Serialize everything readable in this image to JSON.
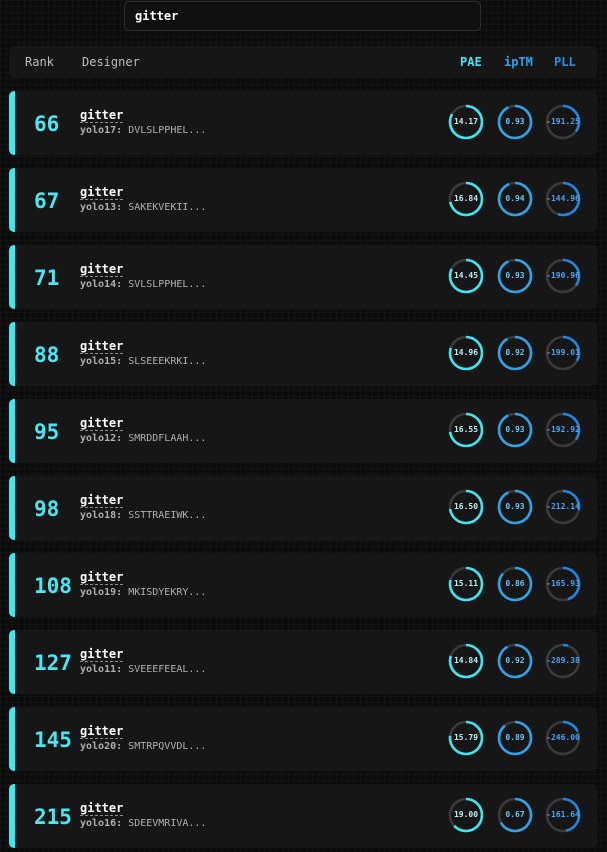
{
  "search": {
    "value": "gitter"
  },
  "header": {
    "rank": "Rank",
    "designer": "Designer",
    "pae": "PAE",
    "iptm": "ipTM",
    "pll": "PLL"
  },
  "colors": {
    "pae": "#3ee6f0",
    "iptm": "#2fa3e8",
    "pll": "#1e86e0",
    "track": "#3a3a3c",
    "accent": "#3ee6f0"
  },
  "rows": [
    {
      "rank": "66",
      "designer": "gitter",
      "model": "yolo17:",
      "sequence": "DVLSLPPHEL...",
      "pae": "14.17",
      "pae_frac": 0.83,
      "iptm": "0.93",
      "iptm_frac": 0.93,
      "pll": "-191.25",
      "pll_frac": 0.35
    },
    {
      "rank": "67",
      "designer": "gitter",
      "model": "yolo13:",
      "sequence": "SAKEKVEKII...",
      "pae": "16.84",
      "pae_frac": 0.72,
      "iptm": "0.94",
      "iptm_frac": 0.94,
      "pll": "-144.96",
      "pll_frac": 0.55
    },
    {
      "rank": "71",
      "designer": "gitter",
      "model": "yolo14:",
      "sequence": "SVLSLPPHEL...",
      "pae": "14.45",
      "pae_frac": 0.82,
      "iptm": "0.93",
      "iptm_frac": 0.93,
      "pll": "-190.96",
      "pll_frac": 0.35
    },
    {
      "rank": "88",
      "designer": "gitter",
      "model": "yolo15:",
      "sequence": "SLSEEEKRKI...",
      "pae": "14.96",
      "pae_frac": 0.8,
      "iptm": "0.92",
      "iptm_frac": 0.92,
      "pll": "-199.01",
      "pll_frac": 0.33
    },
    {
      "rank": "95",
      "designer": "gitter",
      "model": "yolo12:",
      "sequence": "SMRDDFLAAH...",
      "pae": "16.55",
      "pae_frac": 0.73,
      "iptm": "0.93",
      "iptm_frac": 0.93,
      "pll": "-192.92",
      "pll_frac": 0.35
    },
    {
      "rank": "98",
      "designer": "gitter",
      "model": "yolo18:",
      "sequence": "SSTTRAEIWK...",
      "pae": "16.50",
      "pae_frac": 0.73,
      "iptm": "0.93",
      "iptm_frac": 0.93,
      "pll": "-212.14",
      "pll_frac": 0.28
    },
    {
      "rank": "108",
      "designer": "gitter",
      "model": "yolo19:",
      "sequence": "MKISDYEKRY...",
      "pae": "15.11",
      "pae_frac": 0.79,
      "iptm": "0.86",
      "iptm_frac": 0.86,
      "pll": "-165.93",
      "pll_frac": 0.45
    },
    {
      "rank": "127",
      "designer": "gitter",
      "model": "yolo11:",
      "sequence": "SVEEEFEEAL...",
      "pae": "14.84",
      "pae_frac": 0.8,
      "iptm": "0.92",
      "iptm_frac": 0.92,
      "pll": "-289.38",
      "pll_frac": 0.05
    },
    {
      "rank": "145",
      "designer": "gitter",
      "model": "yolo20:",
      "sequence": "SMTRPQVVDL...",
      "pae": "15.79",
      "pae_frac": 0.77,
      "iptm": "0.89",
      "iptm_frac": 0.89,
      "pll": "-246.00",
      "pll_frac": 0.18
    },
    {
      "rank": "215",
      "designer": "gitter",
      "model": "yolo16:",
      "sequence": "SDEEVMRIVA...",
      "pae": "19.00",
      "pae_frac": 0.63,
      "iptm": "0.67",
      "iptm_frac": 0.67,
      "pll": "-161.64",
      "pll_frac": 0.47
    }
  ]
}
